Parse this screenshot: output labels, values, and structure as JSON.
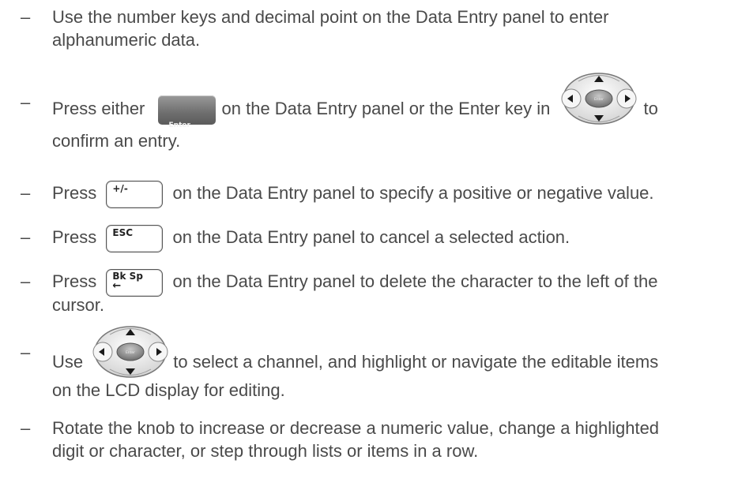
{
  "bullet": "–",
  "items": [
    {
      "line1": "Use the number keys and decimal point on the Data Entry panel to enter",
      "line2": "alphanumeric data."
    },
    {
      "line1_a": "Press either",
      "line1_b": "on the Data Entry panel or the Enter key in",
      "line1_c": "to",
      "line2": "confirm an entry.",
      "key_label": "Enter"
    },
    {
      "a": "Press",
      "b": "on the Data Entry panel to specify a positive or negative value.",
      "key_label": "+/-"
    },
    {
      "a": "Press",
      "b": "on the Data Entry panel to cancel a selected action.",
      "key_label": "ESC"
    },
    {
      "a": "Press",
      "b": "on the Data Entry panel to delete the character to the left of the",
      "line2": "cursor.",
      "key_label_1": "Bk Sp",
      "key_label_2": "←"
    },
    {
      "a": "Use",
      "b": "to select a channel, and highlight or navigate the editable items",
      "line2": "on the LCD display for editing."
    },
    {
      "line1": "Rotate the knob to increase or decrease a numeric value, change a highlighted",
      "line2": "digit or character, or step through lists or items in a row."
    }
  ],
  "icons": {
    "navpad": "navigation-pad-icon",
    "enter_key": "enter-key-icon"
  }
}
